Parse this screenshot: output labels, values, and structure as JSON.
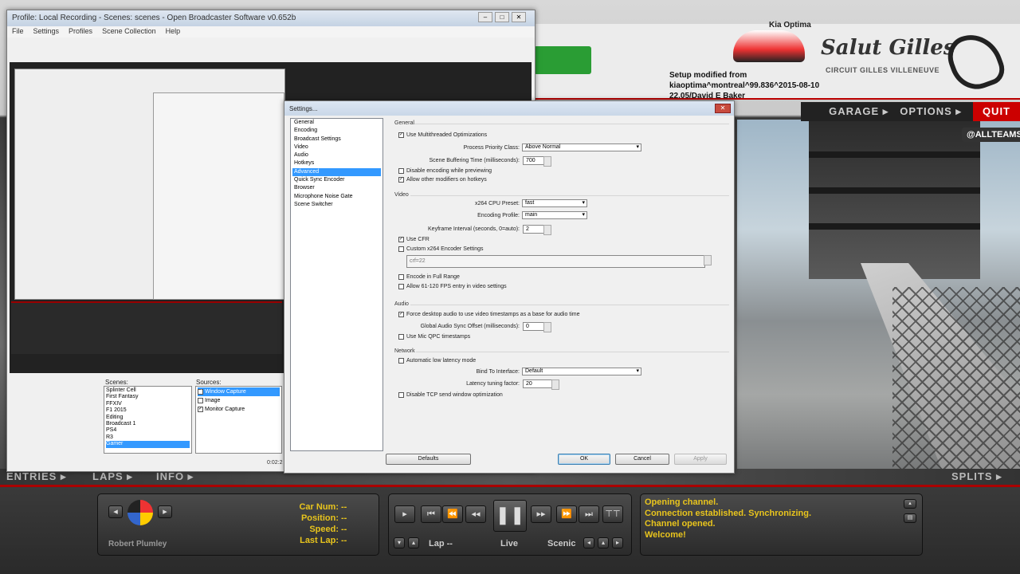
{
  "game": {
    "car_name": "Kia Optima",
    "logo_text": "Salut Gilles",
    "circuit_name": "CIRCUIT GILLES VILLENEUVE",
    "setup_text": "Setup modified from kiaoptima^montreal^99.836^2015-08-10 22.05/David E Baker",
    "nav": [
      "GARAGE ▸",
      "OPTIONS ▸"
    ],
    "quit_label": "QUIT",
    "team_badge": "@ALLTEAMS",
    "bottom_tabs": [
      "ENTRIES ▸",
      "LAPS ▸",
      "INFO ▸"
    ],
    "splits_label": "SPLITS ▸",
    "driver_name": "Robert Plumley",
    "info_labels": [
      "Car Num:",
      "Position:",
      "Speed:",
      "Last Lap:"
    ],
    "info_values": [
      "--",
      "--",
      "--",
      "--"
    ],
    "lap_label": "Lap --",
    "live_label": "Live",
    "scenic_label": "Scenic",
    "messages": [
      "Opening channel.",
      "Connection established.  Synchronizing.",
      "Channel opened.",
      "Welcome!"
    ]
  },
  "obs": {
    "title": "Profile: Local Recording - Scenes: scenes - Open Broadcaster Software v0.652b",
    "menu": [
      "File",
      "Settings",
      "Profiles",
      "Scene Collection",
      "Help"
    ],
    "scenes_label": "Scenes:",
    "sources_label": "Sources:",
    "scenes": [
      "Splinter Cell",
      "First Fantasy",
      "FFXIV",
      "F1 2015",
      "Editing",
      "Broadcast 1",
      "PS4",
      "R3",
      "Gamer"
    ],
    "sources": [
      "Window Capture",
      "Image",
      "Monitor Capture"
    ],
    "timer": "0:02:2"
  },
  "settings": {
    "title": "Settings...",
    "close": "✕",
    "nav_items": [
      "General",
      "Encoding",
      "Broadcast Settings",
      "Video",
      "Audio",
      "Hotkeys",
      "Advanced",
      "Quick Sync Encoder",
      "Browser",
      "Microphone Noise Gate",
      "Scene Switcher"
    ],
    "selected_nav": "Advanced",
    "general": {
      "label": "General",
      "multithreaded": "Use Multithreaded Optimizations",
      "priority_label": "Process Priority Class:",
      "priority_value": "Above Normal",
      "buffering_label": "Scene Buffering Time (milliseconds):",
      "buffering_value": "700",
      "disable_encoding": "Disable encoding while previewing",
      "allow_modifiers": "Allow other modifiers on hotkeys"
    },
    "video": {
      "label": "Video",
      "preset_label": "x264 CPU Preset:",
      "preset_value": "fast",
      "profile_label": "Encoding Profile:",
      "profile_value": "main",
      "keyframe_label": "Keyframe Interval (seconds, 0=auto):",
      "keyframe_value": "2",
      "use_cfr": "Use CFR",
      "custom_x264": "Custom x264 Encoder Settings",
      "custom_value": "crf=22",
      "full_range": "Encode in Full Range",
      "allow_fps": "Allow 61-120 FPS entry in video settings"
    },
    "audio": {
      "label": "Audio",
      "force_desktop": "Force desktop audio to use video timestamps as a base for audio time",
      "sync_label": "Global Audio Sync Offset (milliseconds):",
      "sync_value": "0",
      "qpc": "Use Mic QPC timestamps"
    },
    "network": {
      "label": "Network",
      "low_latency": "Automatic low latency mode",
      "bind_label": "Bind To Interface:",
      "bind_value": "Default",
      "latency_label": "Latency tuning factor:",
      "latency_value": "20",
      "tcp_opt": "Disable TCP send window optimization"
    },
    "buttons": {
      "defaults": "Defaults",
      "ok": "OK",
      "cancel": "Cancel",
      "apply": "Apply"
    }
  }
}
